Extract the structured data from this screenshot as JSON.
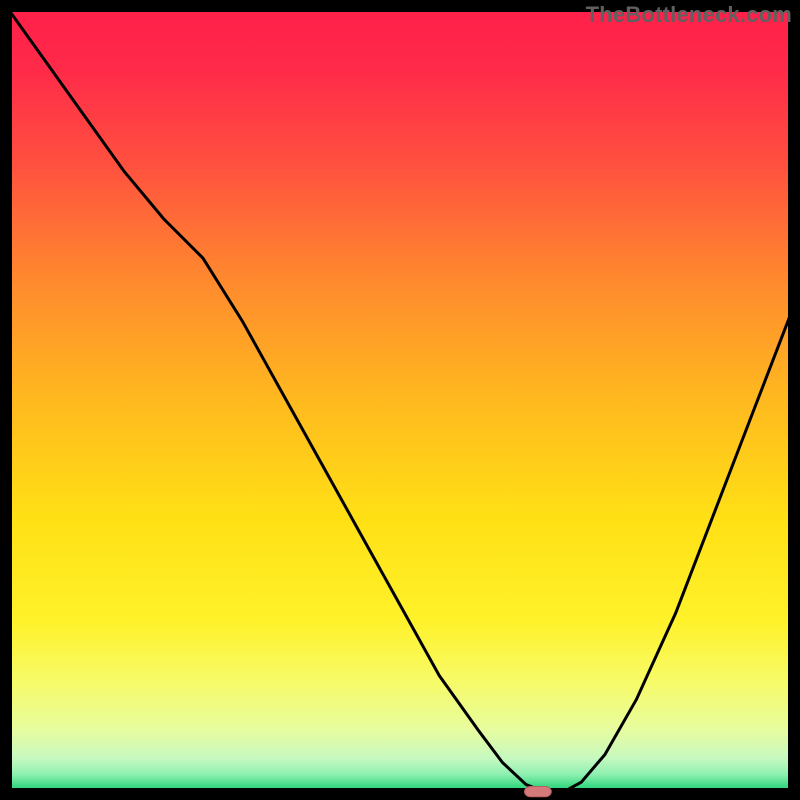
{
  "watermark": "TheBottleneck.com",
  "colors": {
    "gradient_stops": [
      {
        "offset": 0.0,
        "color": "#ff1f4a"
      },
      {
        "offset": 0.08,
        "color": "#ff2a49"
      },
      {
        "offset": 0.2,
        "color": "#ff503f"
      },
      {
        "offset": 0.35,
        "color": "#ff8a2e"
      },
      {
        "offset": 0.5,
        "color": "#ffb91f"
      },
      {
        "offset": 0.65,
        "color": "#ffe015"
      },
      {
        "offset": 0.78,
        "color": "#fff22a"
      },
      {
        "offset": 0.86,
        "color": "#f6fb6a"
      },
      {
        "offset": 0.92,
        "color": "#e6fca0"
      },
      {
        "offset": 0.955,
        "color": "#c6f9c0"
      },
      {
        "offset": 0.975,
        "color": "#8ef0b0"
      },
      {
        "offset": 0.99,
        "color": "#3cd984"
      },
      {
        "offset": 1.0,
        "color": "#1fc772"
      }
    ],
    "curve": "#000000",
    "frame": "#000000",
    "marker_fill": "#d47a7a",
    "marker_stroke": "#b85f5f"
  },
  "chart_data": {
    "type": "line",
    "title": "",
    "xlabel": "",
    "ylabel": "",
    "xlim": [
      0,
      100
    ],
    "ylim": [
      0,
      100
    ],
    "grid": false,
    "legend": false,
    "series": [
      {
        "name": "bottleneck-curve",
        "x": [
          0,
          5,
          10,
          15,
          20,
          25,
          30,
          35,
          40,
          45,
          50,
          55,
          60,
          63,
          66,
          68,
          69.5,
          71,
          73,
          76,
          80,
          85,
          90,
          95,
          100
        ],
        "y": [
          100,
          93,
          86,
          79,
          73,
          68,
          60,
          51,
          42,
          33,
          24,
          15,
          8,
          4,
          1.2,
          0.4,
          0.2,
          0.4,
          1.5,
          5,
          12,
          23,
          36,
          49,
          62
        ]
      }
    ],
    "flat_bottom": {
      "x_start": 63.5,
      "x_end": 70.5,
      "y": 0.2
    },
    "marker": {
      "x": 67.5,
      "y": 0.3,
      "width_pct": 3.4,
      "height_pct": 1.3
    },
    "annotations": []
  }
}
